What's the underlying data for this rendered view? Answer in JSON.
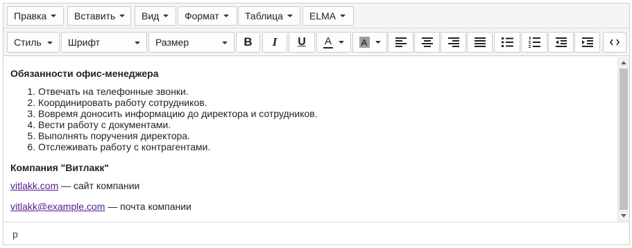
{
  "menubar": {
    "items": [
      {
        "label": "Правка"
      },
      {
        "label": "Вставить"
      },
      {
        "label": "Вид"
      },
      {
        "label": "Формат"
      },
      {
        "label": "Таблица"
      },
      {
        "label": "ELMA"
      }
    ]
  },
  "toolbar": {
    "style_label": "Стиль",
    "font_label": "Шрифт",
    "size_label": "Размер",
    "icons": {
      "bold": "bold-icon",
      "italic": "italic-icon",
      "underline": "underline-icon",
      "text_color": "text-color-icon",
      "background_color": "background-color-icon",
      "align_left": "align-left-icon",
      "align_center": "align-center-icon",
      "align_right": "align-right-icon",
      "align_justify": "align-justify-icon",
      "bullet_list": "bullet-list-icon",
      "numbered_list": "numbered-list-icon",
      "outdent": "outdent-icon",
      "indent": "indent-icon",
      "source_code": "source-code-icon"
    },
    "bold_glyph": "B",
    "italic_glyph": "I",
    "underline_glyph": "U",
    "text_color_glyph": "A",
    "background_color_glyph": "A"
  },
  "content": {
    "heading1": "Обязанности офис-менеджера",
    "duties": [
      "Отвечать на телефонные звонки.",
      "Координировать работу сотрудников.",
      "Вовремя доносить информацию до директора и сотрудников.",
      "Вести работу с документами.",
      "Выполнять поручения директора.",
      "Отслеживать работу с контрагентами."
    ],
    "heading2": "Компания \"Витлакк\"",
    "site_link": "vitlakk.com",
    "site_suffix": " — сайт компании",
    "email_link": "vitlakk@example.com",
    "email_suffix": " — почта компании"
  },
  "statusbar": {
    "path": "p"
  },
  "colors": {
    "toolbar_bg": "#f5f5f5",
    "button_border": "#cccccc",
    "link": "#551a8b",
    "highlight_swatch": "#9e9e9e"
  }
}
